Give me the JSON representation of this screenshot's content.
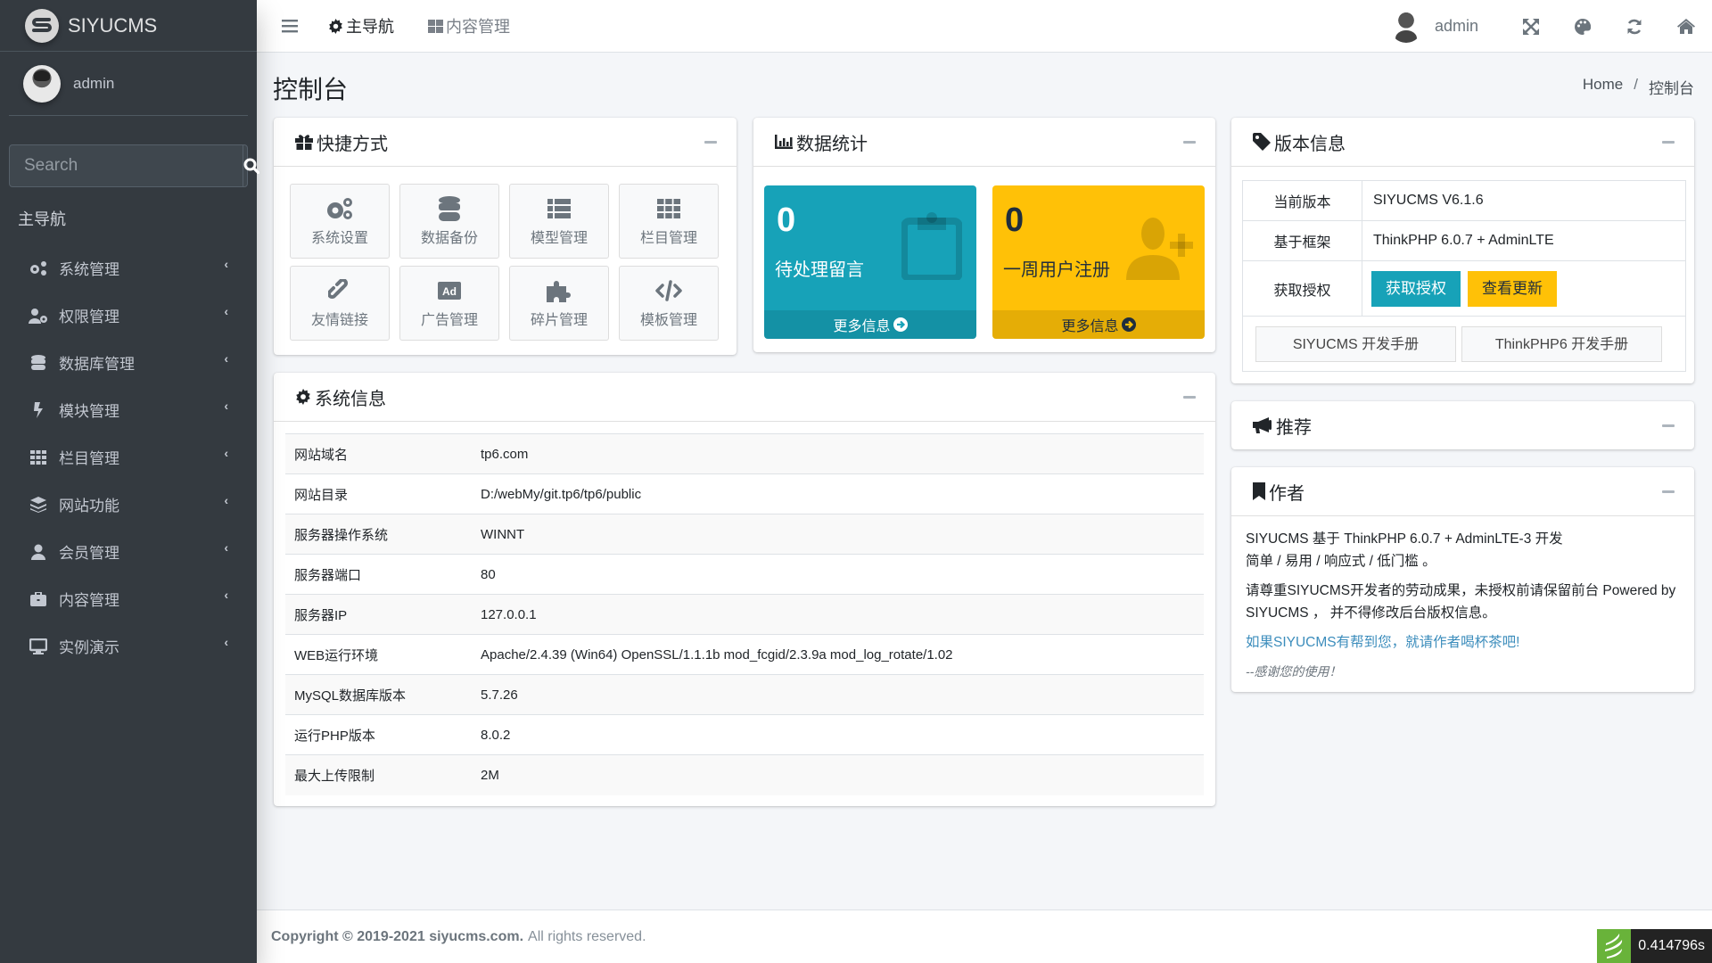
{
  "brand": {
    "name": "SIYUCMS",
    "logo_letter": "S"
  },
  "user": {
    "name": "admin"
  },
  "search": {
    "placeholder": "Search"
  },
  "sidebar": {
    "header": "主导航",
    "items": [
      {
        "label": "系统管理",
        "icon": "cogs-icon"
      },
      {
        "label": "权限管理",
        "icon": "user-cog-icon"
      },
      {
        "label": "数据库管理",
        "icon": "database-icon"
      },
      {
        "label": "模块管理",
        "icon": "bolt-icon"
      },
      {
        "label": "栏目管理",
        "icon": "th-icon"
      },
      {
        "label": "网站功能",
        "icon": "layer-group-icon"
      },
      {
        "label": "会员管理",
        "icon": "user-icon"
      },
      {
        "label": "内容管理",
        "icon": "briefcase-icon"
      },
      {
        "label": "实例演示",
        "icon": "desktop-icon"
      }
    ]
  },
  "topbar": {
    "links": [
      {
        "label": "主导航",
        "icon": "cog-icon"
      },
      {
        "label": "内容管理",
        "icon": "th-large-icon"
      }
    ],
    "user": "admin"
  },
  "content_header": {
    "title": "控制台",
    "breadcrumb": [
      {
        "label": "Home"
      },
      {
        "label": "控制台"
      }
    ],
    "separator": "/"
  },
  "shortcuts": {
    "title": "快捷方式",
    "items": [
      {
        "label": "系统设置",
        "icon": "cogs-icon"
      },
      {
        "label": "数据备份",
        "icon": "database-icon"
      },
      {
        "label": "模型管理",
        "icon": "th-list-icon"
      },
      {
        "label": "栏目管理",
        "icon": "th-icon"
      },
      {
        "label": "友情链接",
        "icon": "link-icon"
      },
      {
        "label": "广告管理",
        "icon": "ad-icon"
      },
      {
        "label": "碎片管理",
        "icon": "puzzle-icon"
      },
      {
        "label": "模板管理",
        "icon": "code-icon"
      }
    ]
  },
  "stats": {
    "title": "数据统计",
    "boxes": [
      {
        "value": "0",
        "label": "待处理留言",
        "more": "更多信息",
        "color": "#17a2b8"
      },
      {
        "value": "0",
        "label": "一周用户注册",
        "more": "更多信息",
        "color": "#ffc107"
      }
    ]
  },
  "version": {
    "title": "版本信息",
    "rows": [
      {
        "key": "当前版本",
        "value": "SIYUCMS V6.1.6"
      },
      {
        "key": "基于框架",
        "value": "ThinkPHP 6.0.7 + AdminLTE"
      },
      {
        "key": "获取授权"
      }
    ],
    "buttons": {
      "license": "获取授权",
      "update": "查看更新"
    },
    "docs": [
      "SIYUCMS 开发手册",
      "ThinkPHP6 开发手册"
    ]
  },
  "sysinfo": {
    "title": "系统信息",
    "rows": [
      {
        "key": "网站域名",
        "value": "tp6.com"
      },
      {
        "key": "网站目录",
        "value": "D:/webMy/git.tp6/tp6/public"
      },
      {
        "key": "服务器操作系统",
        "value": "WINNT"
      },
      {
        "key": "服务器端口",
        "value": "80"
      },
      {
        "key": "服务器IP",
        "value": "127.0.0.1"
      },
      {
        "key": "WEB运行环境",
        "value": "Apache/2.4.39 (Win64) OpenSSL/1.1.1b mod_fcgid/2.3.9a mod_log_rotate/1.02"
      },
      {
        "key": "MySQL数据库版本",
        "value": "5.7.26"
      },
      {
        "key": "运行PHP版本",
        "value": "8.0.2"
      },
      {
        "key": "最大上传限制",
        "value": "2M"
      }
    ]
  },
  "recommend": {
    "title": "推荐"
  },
  "author": {
    "title": "作者",
    "line1": "SIYUCMS 基于 ThinkPHP 6.0.7 + AdminLTE-3 开发",
    "line2": "简单 / 易用 / 响应式 / 低门槛 。",
    "notice": "请尊重SIYUCMS开发者的劳动成果，未授权前请保留前台 Powered by SIYUCMS ， 并不得修改后台版权信息。",
    "link": "如果SIYUCMS有帮到您，就请作者喝杯茶吧!",
    "thanks": "--感谢您的使用！"
  },
  "footer": {
    "bold": "Copyright © 2019-2021 siyucms.com.",
    "rest": "All rights reserved."
  },
  "trace": {
    "time": "0.414796s"
  }
}
